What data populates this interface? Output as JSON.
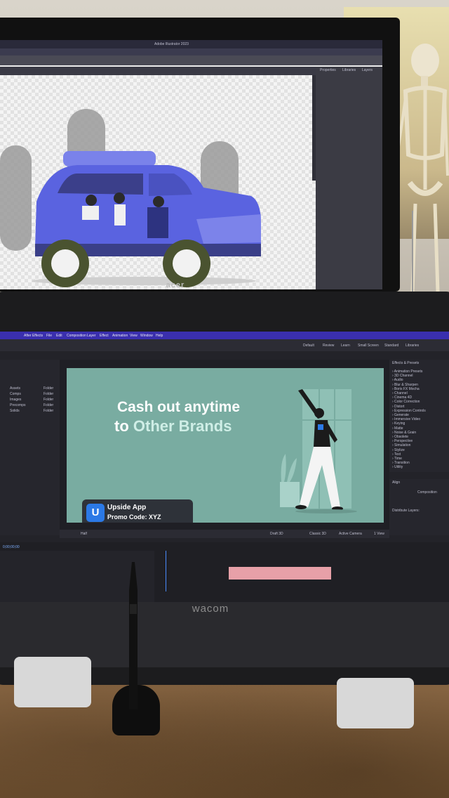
{
  "illustrator": {
    "title": "Adobe Illustrator 2023",
    "panel_tabs": [
      "Properties",
      "Libraries",
      "Layers"
    ]
  },
  "monitor_brand": "acer",
  "after_effects": {
    "menu": [
      "After Effects",
      "File",
      "Edit",
      "Composition",
      "Layer",
      "Effect",
      "Animation",
      "View",
      "Window",
      "Help"
    ],
    "workspace_tabs": [
      "Default",
      "Review",
      "Learn",
      "Small Screen",
      "Standard",
      "Libraries"
    ],
    "effects_header": "Effects & Presets",
    "effects_items": [
      "Animation Presets",
      "3D Channel",
      "Audio",
      "Blur & Sharpen",
      "Boris FX Mocha",
      "Channel",
      "Cinema 4D",
      "Color Correction",
      "Distort",
      "Expression Controls",
      "Generate",
      "Immersive Video",
      "Keying",
      "Matte",
      "Noise & Grain",
      "Obsolete",
      "Perspective",
      "Simulation",
      "Stylize",
      "Text",
      "Time",
      "Transition",
      "Utility"
    ],
    "align_header": "Align",
    "align_to": "Composition",
    "distribute": "Distribute Layers:",
    "project_items": [
      "Assets",
      "Comps",
      "Images",
      "Precomps",
      "Solids"
    ],
    "project_type": "Folder",
    "viewer": {
      "zoom": "Half",
      "renderer": "Classic 3D",
      "camera": "Active Camera",
      "views": "1 View",
      "quality": "Draft 3D"
    },
    "timeline_time": "0;00;00;00"
  },
  "composition": {
    "line1": "Cash out anytime",
    "line2_prefix": "to ",
    "line2_accent": "Other Brands",
    "promo_title": "Upside App",
    "promo_code": "Promo Code: XYZ",
    "promo_logo": "U"
  },
  "tablet_brand": "wacom",
  "colors": {
    "comp_bg": "#79aca1",
    "car_blue": "#5a63e0",
    "ae_menubar": "#3a2fae",
    "promo_bg": "#2e3239",
    "accent_text": "#cfeee6"
  }
}
